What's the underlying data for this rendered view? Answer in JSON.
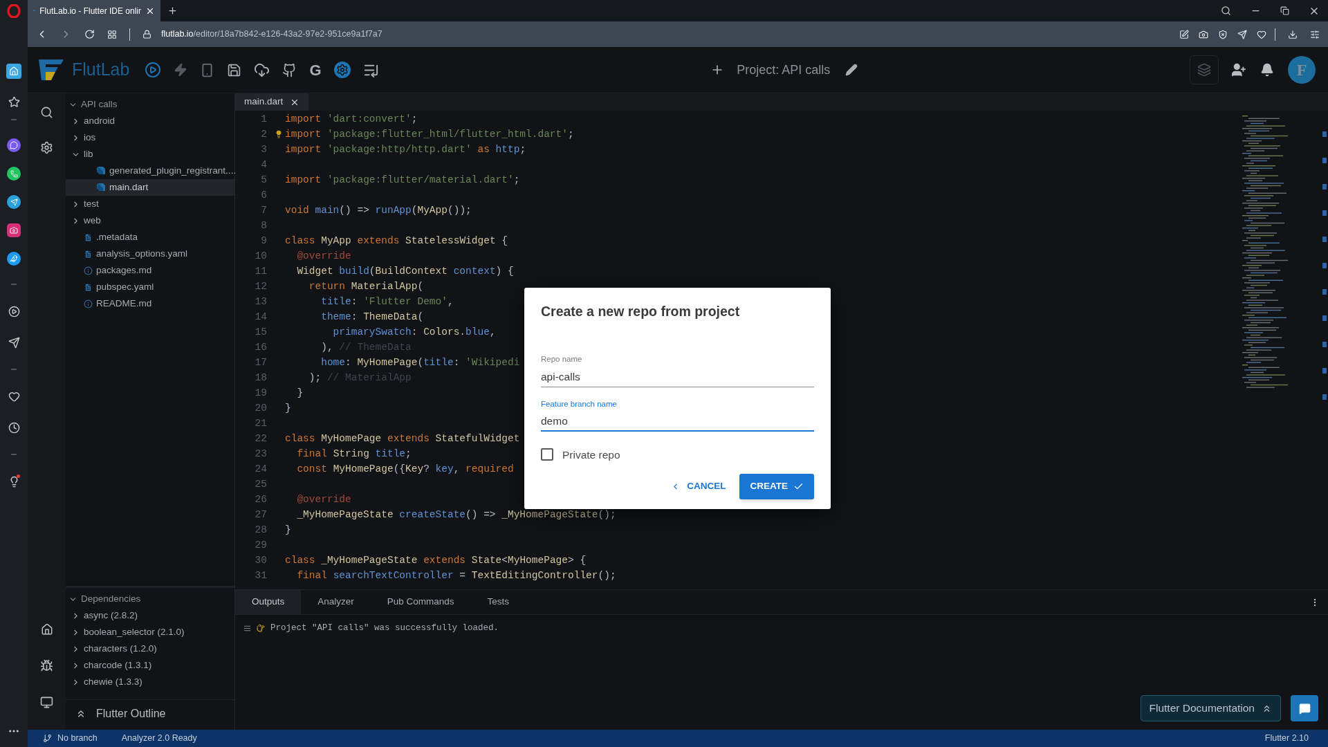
{
  "browser": {
    "tab_title": "FlutLab.io - Flutter IDE onlir",
    "url_host": "flutlab.io",
    "url_path": "/editor/18a7b842-e126-43a2-97e2-951ce9a1f7a7"
  },
  "toolbar": {
    "logo_text": "FlutLab",
    "letter_button": "G",
    "project_title": "Project: API calls",
    "avatar_letter": "F"
  },
  "file_tree": {
    "label": "API calls",
    "expanded": true,
    "children": [
      {
        "label": "android",
        "kind": "folder",
        "expanded": false,
        "selected": false
      },
      {
        "label": "ios",
        "kind": "folder",
        "expanded": false,
        "selected": false
      },
      {
        "label": "lib",
        "kind": "folder",
        "expanded": true,
        "selected": false,
        "children": [
          {
            "label": "generated_plugin_registrant....",
            "kind": "dart",
            "selected": false
          },
          {
            "label": "main.dart",
            "kind": "dart",
            "selected": true
          }
        ]
      },
      {
        "label": "test",
        "kind": "folder",
        "expanded": false,
        "selected": false
      },
      {
        "label": "web",
        "kind": "folder",
        "expanded": false,
        "selected": false
      },
      {
        "label": ".metadata",
        "kind": "file",
        "selected": false
      },
      {
        "label": "analysis_options.yaml",
        "kind": "file",
        "selected": false
      },
      {
        "label": "packages.md",
        "kind": "info",
        "selected": false
      },
      {
        "label": "pubspec.yaml",
        "kind": "file",
        "selected": false
      },
      {
        "label": "README.md",
        "kind": "info",
        "selected": false
      }
    ]
  },
  "dependencies": {
    "label": "Dependencies",
    "expanded": true,
    "items": [
      {
        "label": "async (2.8.2)",
        "expanded": false
      },
      {
        "label": "boolean_selector (2.1.0)",
        "expanded": false
      },
      {
        "label": "characters (1.2.0)",
        "expanded": false
      },
      {
        "label": "charcode (1.3.1)",
        "expanded": false
      },
      {
        "label": "chewie (1.3.3)",
        "expanded": false
      }
    ]
  },
  "outline": {
    "label": "Flutter Outline"
  },
  "editor_tabs": [
    {
      "label": "main.dart",
      "selected": true
    }
  ],
  "code_lines": [
    {
      "number": "1",
      "tokens": [
        {
          "kind": "kw",
          "text": "import "
        },
        {
          "kind": "str",
          "text": "'dart:convert'"
        },
        {
          "kind": "p",
          "text": ";"
        }
      ]
    },
    {
      "number": "2",
      "tokens": [
        {
          "kind": "kw",
          "text": "import "
        },
        {
          "kind": "str",
          "text": "'package:flutter_html/flutter_html.dart'"
        },
        {
          "kind": "p",
          "text": ";"
        }
      ]
    },
    {
      "number": "3",
      "tokens": [
        {
          "kind": "kw",
          "text": "import "
        },
        {
          "kind": "str",
          "text": "'package:http/http.dart'"
        },
        {
          "kind": "kw",
          "text": " as "
        },
        {
          "kind": "fn",
          "text": "http"
        },
        {
          "kind": "p",
          "text": ";"
        }
      ]
    },
    {
      "number": "4"
    },
    {
      "number": "5",
      "tokens": [
        {
          "kind": "kw",
          "text": "import "
        },
        {
          "kind": "str",
          "text": "'package:flutter/material.dart'"
        },
        {
          "kind": "p",
          "text": ";"
        }
      ]
    },
    {
      "number": "6"
    },
    {
      "number": "7",
      "tokens": [
        {
          "kind": "kw",
          "text": "void "
        },
        {
          "kind": "fn",
          "text": "main"
        },
        {
          "kind": "p",
          "text": "() => "
        },
        {
          "kind": "fn",
          "text": "runApp"
        },
        {
          "kind": "p",
          "text": "("
        },
        {
          "kind": "ty",
          "text": "MyApp"
        },
        {
          "kind": "p",
          "text": "());"
        }
      ]
    },
    {
      "number": "8"
    },
    {
      "number": "9",
      "tokens": [
        {
          "kind": "kw",
          "text": "class "
        },
        {
          "kind": "ty",
          "text": "MyApp"
        },
        {
          "kind": "kw",
          "text": " extends "
        },
        {
          "kind": "ty",
          "text": "StatelessWidget"
        },
        {
          "kind": "p",
          "text": " {"
        }
      ]
    },
    {
      "number": "10",
      "tokens": [
        {
          "kind": "an",
          "text": "  @override"
        }
      ]
    },
    {
      "number": "11",
      "tokens": [
        {
          "kind": "ty",
          "text": "  Widget "
        },
        {
          "kind": "fn",
          "text": "build"
        },
        {
          "kind": "p",
          "text": "("
        },
        {
          "kind": "ty",
          "text": "BuildContext "
        },
        {
          "kind": "fn",
          "text": "context"
        },
        {
          "kind": "p",
          "text": ") {"
        }
      ]
    },
    {
      "number": "12",
      "tokens": [
        {
          "kind": "kw",
          "text": "    return "
        },
        {
          "kind": "ty",
          "text": "MaterialApp"
        },
        {
          "kind": "p",
          "text": "("
        }
      ]
    },
    {
      "number": "13",
      "tokens": [
        {
          "kind": "fn",
          "text": "      title"
        },
        {
          "kind": "p",
          "text": ": "
        },
        {
          "kind": "str",
          "text": "'Flutter Demo'"
        },
        {
          "kind": "p",
          "text": ","
        }
      ]
    },
    {
      "number": "14",
      "tokens": [
        {
          "kind": "fn",
          "text": "      theme"
        },
        {
          "kind": "p",
          "text": ": "
        },
        {
          "kind": "ty",
          "text": "ThemeData"
        },
        {
          "kind": "p",
          "text": "("
        }
      ]
    },
    {
      "number": "15",
      "tokens": [
        {
          "kind": "fn",
          "text": "        primarySwatch"
        },
        {
          "kind": "p",
          "text": ": "
        },
        {
          "kind": "ty",
          "text": "Colors"
        },
        {
          "kind": "p",
          "text": "."
        },
        {
          "kind": "fn",
          "text": "blue"
        },
        {
          "kind": "p",
          "text": ","
        }
      ]
    },
    {
      "number": "16",
      "tokens": [
        {
          "kind": "p",
          "text": "      ), "
        },
        {
          "kind": "cm",
          "text": "// ThemeData"
        }
      ]
    },
    {
      "number": "17",
      "tokens": [
        {
          "kind": "fn",
          "text": "      home"
        },
        {
          "kind": "p",
          "text": ": "
        },
        {
          "kind": "ty",
          "text": "MyHomePage"
        },
        {
          "kind": "p",
          "text": "("
        },
        {
          "kind": "fn",
          "text": "title"
        },
        {
          "kind": "p",
          "text": ": "
        },
        {
          "kind": "str",
          "text": "'Wikipedi"
        }
      ]
    },
    {
      "number": "18",
      "tokens": [
        {
          "kind": "p",
          "text": "    ); "
        },
        {
          "kind": "cm",
          "text": "// MaterialApp"
        }
      ]
    },
    {
      "number": "19",
      "tokens": [
        {
          "kind": "p",
          "text": "  }"
        }
      ]
    },
    {
      "number": "20",
      "tokens": [
        {
          "kind": "p",
          "text": "}"
        }
      ]
    },
    {
      "number": "21"
    },
    {
      "number": "22",
      "tokens": [
        {
          "kind": "kw",
          "text": "class "
        },
        {
          "kind": "ty",
          "text": "MyHomePage"
        },
        {
          "kind": "kw",
          "text": " extends "
        },
        {
          "kind": "ty",
          "text": "StatefulWidget"
        }
      ]
    },
    {
      "number": "23",
      "tokens": [
        {
          "kind": "kw",
          "text": "  final "
        },
        {
          "kind": "ty",
          "text": "String "
        },
        {
          "kind": "fn",
          "text": "title"
        },
        {
          "kind": "p",
          "text": ";"
        }
      ]
    },
    {
      "number": "24",
      "tokens": [
        {
          "kind": "kw",
          "text": "  const "
        },
        {
          "kind": "ty",
          "text": "MyHomePage"
        },
        {
          "kind": "p",
          "text": "({"
        },
        {
          "kind": "ty",
          "text": "Key"
        },
        {
          "kind": "p",
          "text": "? "
        },
        {
          "kind": "fn",
          "text": "key"
        },
        {
          "kind": "p",
          "text": ", "
        },
        {
          "kind": "kw",
          "text": "required"
        }
      ]
    },
    {
      "number": "25"
    },
    {
      "number": "26",
      "tokens": [
        {
          "kind": "an",
          "text": "  @override"
        }
      ]
    },
    {
      "number": "27",
      "tokens": [
        {
          "kind": "ty",
          "text": "  _MyHomePageState "
        },
        {
          "kind": "fn",
          "text": "createState"
        },
        {
          "kind": "p",
          "text": "() => "
        },
        {
          "kind": "ty",
          "text": "_MyHomePageState"
        },
        {
          "kind": "p",
          "text": "();"
        }
      ]
    },
    {
      "number": "28",
      "tokens": [
        {
          "kind": "p",
          "text": "}"
        }
      ]
    },
    {
      "number": "29"
    },
    {
      "number": "30",
      "tokens": [
        {
          "kind": "kw",
          "text": "class "
        },
        {
          "kind": "ty",
          "text": "_MyHomePageState"
        },
        {
          "kind": "kw",
          "text": " extends "
        },
        {
          "kind": "ty",
          "text": "State"
        },
        {
          "kind": "p",
          "text": "<"
        },
        {
          "kind": "ty",
          "text": "MyHomePage"
        },
        {
          "kind": "p",
          "text": "> {"
        }
      ]
    },
    {
      "number": "31",
      "tokens": [
        {
          "kind": "kw",
          "text": "  final "
        },
        {
          "kind": "fn",
          "text": "searchTextController"
        },
        {
          "kind": "p",
          "text": " = "
        },
        {
          "kind": "ty",
          "text": "TextEditingController"
        },
        {
          "kind": "p",
          "text": "();"
        }
      ]
    }
  ],
  "dialog": {
    "title": "Create a new repo from project",
    "fields": [
      {
        "label": "Repo name",
        "value": "api-calls",
        "focused": false
      },
      {
        "label": "Feature branch name",
        "value": "demo",
        "focused": true
      }
    ],
    "checkbox": {
      "label": "Private repo",
      "checked": false
    },
    "cancel_button": "CANCEL",
    "create_button": "CREATE"
  },
  "bottom_tabs": [
    {
      "label": "Outputs",
      "selected": true
    },
    {
      "label": "Analyzer",
      "selected": false
    },
    {
      "label": "Pub Commands",
      "selected": false
    },
    {
      "label": "Tests",
      "selected": false
    }
  ],
  "output_lines": [
    "Project \"API calls\" was successfully loaded."
  ],
  "docs_button": "Flutter Documentation",
  "status_bar": {
    "branch": "No branch",
    "analyzer": "Analyzer 2.0 Ready",
    "version": "Flutter 2.10"
  }
}
